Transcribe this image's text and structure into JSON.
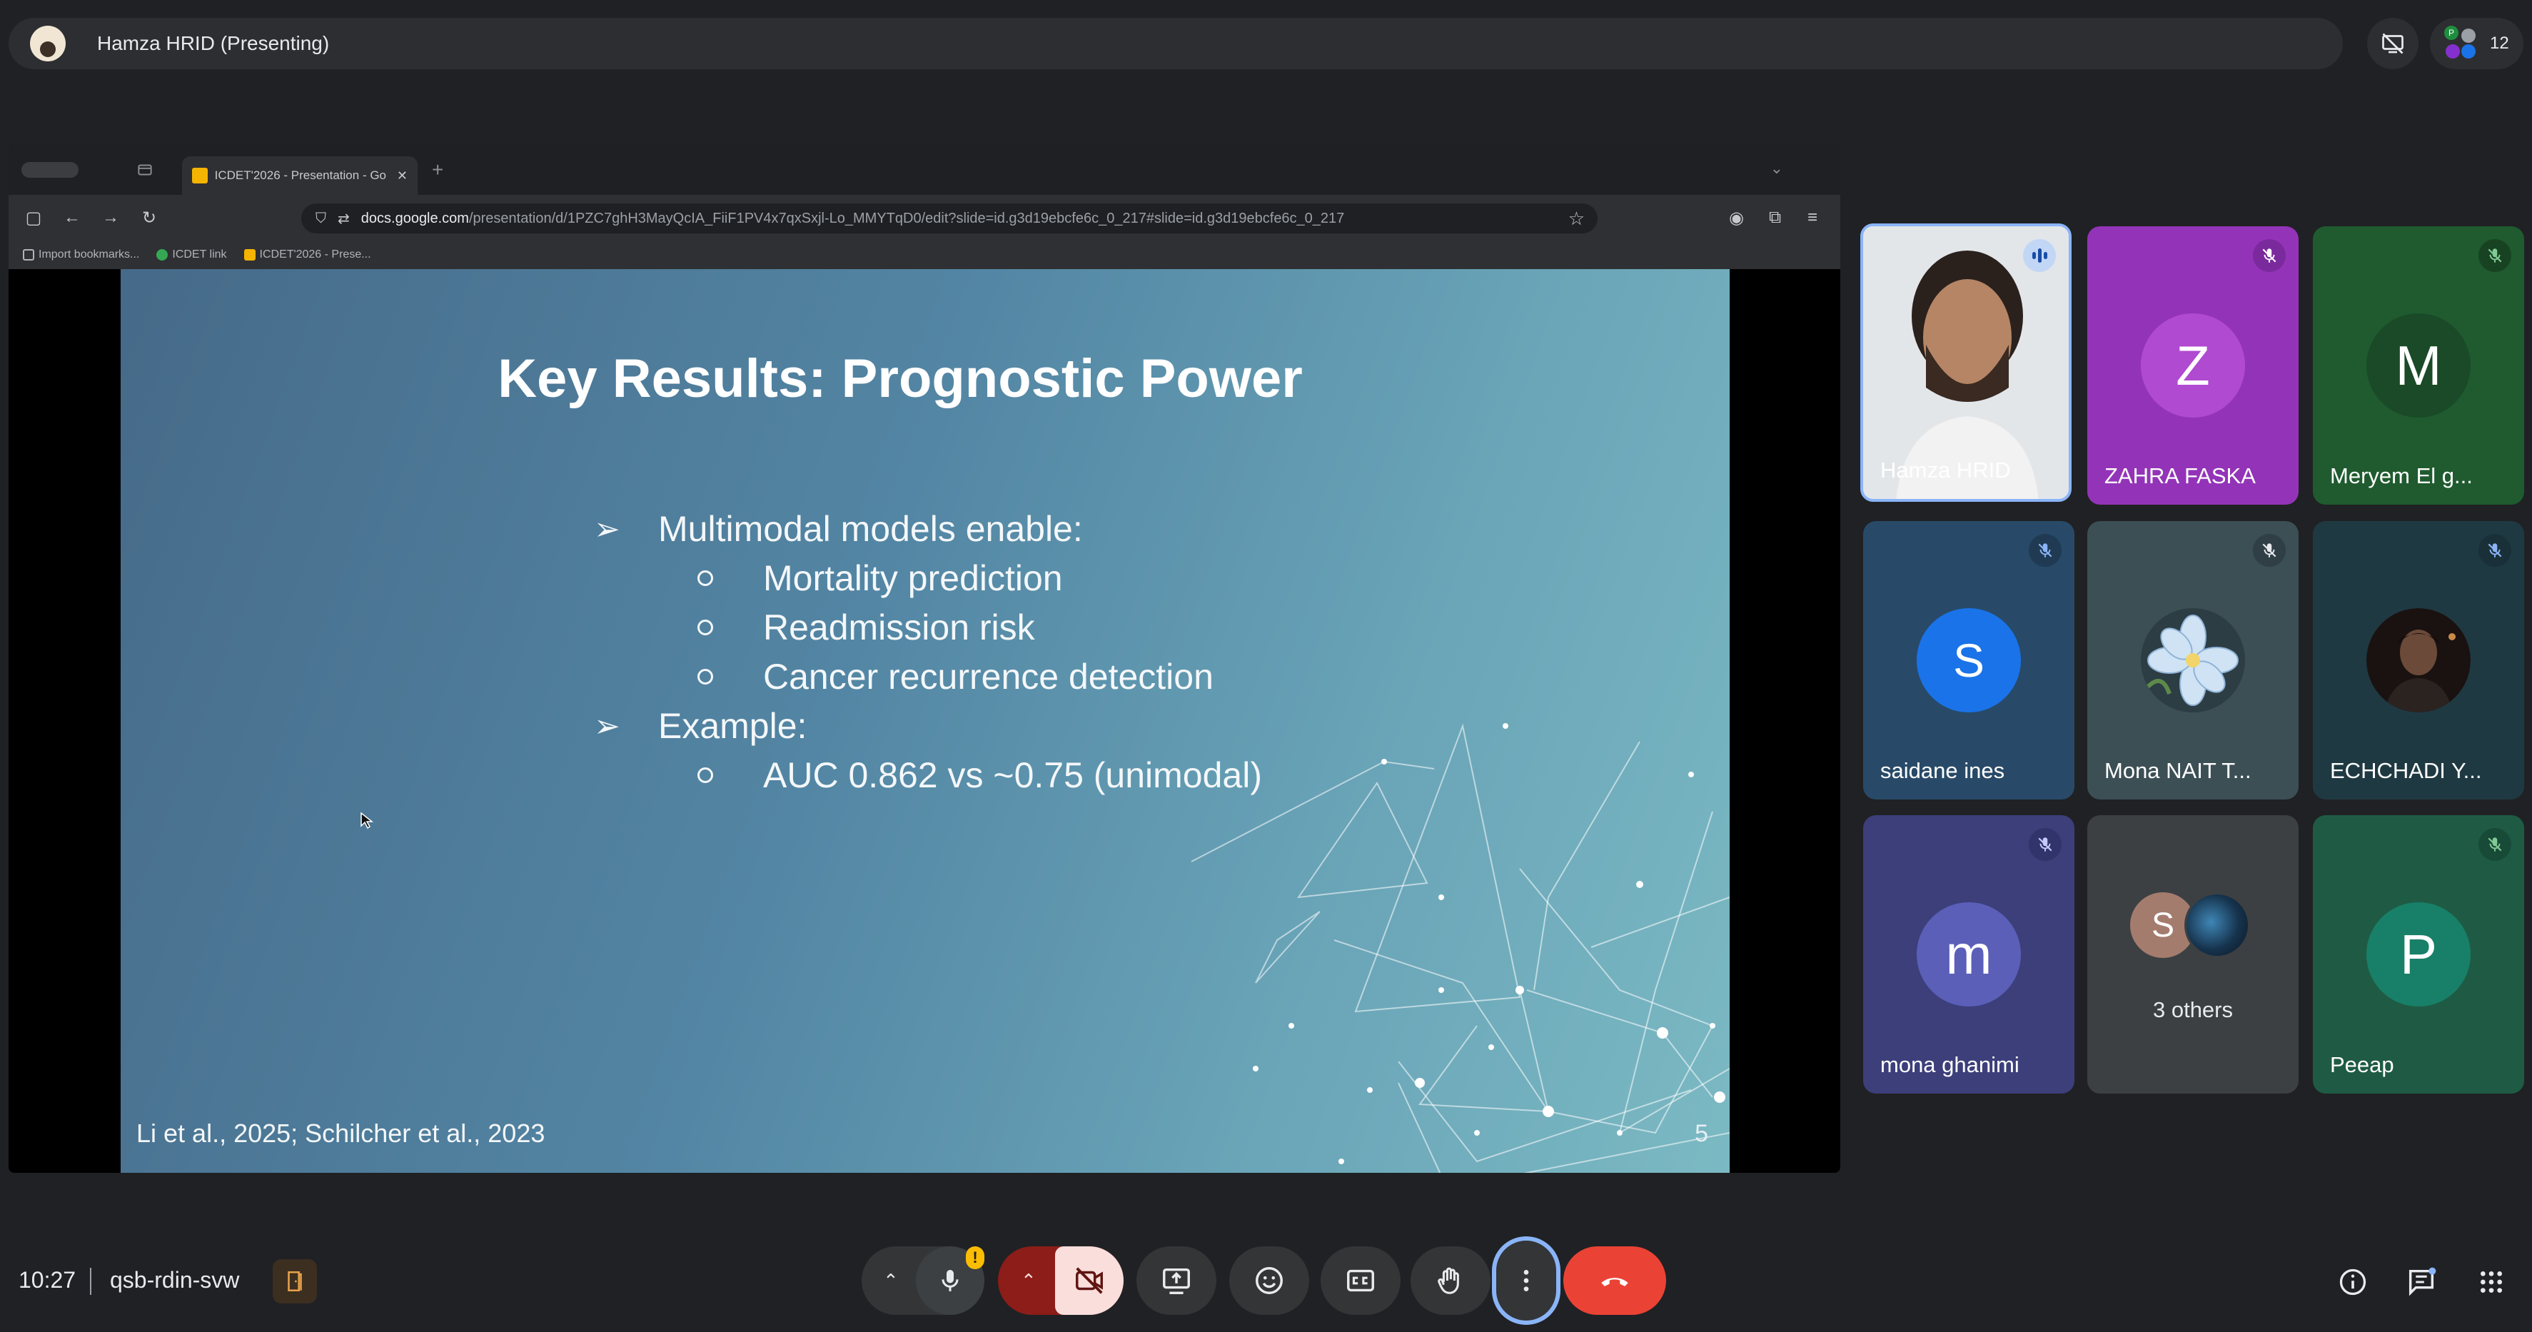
{
  "colors": {
    "background": "#202124",
    "leave_red": "#ea4335",
    "camera_off_bg": "#f9dedc",
    "speaking_blue": "#c2d6f6",
    "warning_yellow": "#fbbc04"
  },
  "topbar": {
    "presenter_label": "Hamza HRID (Presenting)",
    "participant_count": "12",
    "participant_dots_text": "P"
  },
  "browser": {
    "tab_title": "ICDET'2026 - Presentation - Go",
    "url_domain": "docs.google.com",
    "url_path": "/presentation/d/1PZC7ghH3MayQcIA_FiiF1PV4x7qxSxjl-Lo_MMYTqD0/edit?slide=id.g3d19ebcfe6c_0_217#slide=id.g3d19ebcfe6c_0_217",
    "bookmarks": [
      "Import bookmarks...",
      "ICDET link",
      "ICDET'2026 - Prese..."
    ]
  },
  "slide": {
    "title": "Key Results: Prognostic Power",
    "bullet1": "Multimodal models enable:",
    "sub1": "Mortality prediction",
    "sub2": "Readmission risk",
    "sub3": "Cancer recurrence detection",
    "bullet2": "Example:",
    "sub4": "AUC 0.862 vs ~0.75 (unimodal)",
    "citation": "Li et al., 2025; Schilcher et al., 2023",
    "page_number": "5",
    "arrow_glyph": "➢"
  },
  "participants": {
    "p1": {
      "name": "Hamza HRID",
      "state": "speaking"
    },
    "p2": {
      "name": "ZAHRA FASKA",
      "initial": "Z",
      "state": "muted"
    },
    "p3": {
      "name": "Meryem El g...",
      "initial": "M",
      "state": "muted"
    },
    "p4": {
      "name": "saidane ines",
      "initial": "S",
      "state": "muted"
    },
    "p5": {
      "name": "Mona NAIT T...",
      "state": "muted"
    },
    "p6": {
      "name": "ECHCHADI Y...",
      "state": "muted"
    },
    "p7": {
      "name": "mona ghanimi",
      "initial": "m",
      "state": "muted"
    },
    "p8": {
      "name": "3 others",
      "initial": "S"
    },
    "p9": {
      "name": "Peeap",
      "initial": "P",
      "state": "muted"
    }
  },
  "bottombar": {
    "time": "10:27",
    "meeting_code": "qsb-rdin-svw",
    "warning_badge": "!"
  }
}
